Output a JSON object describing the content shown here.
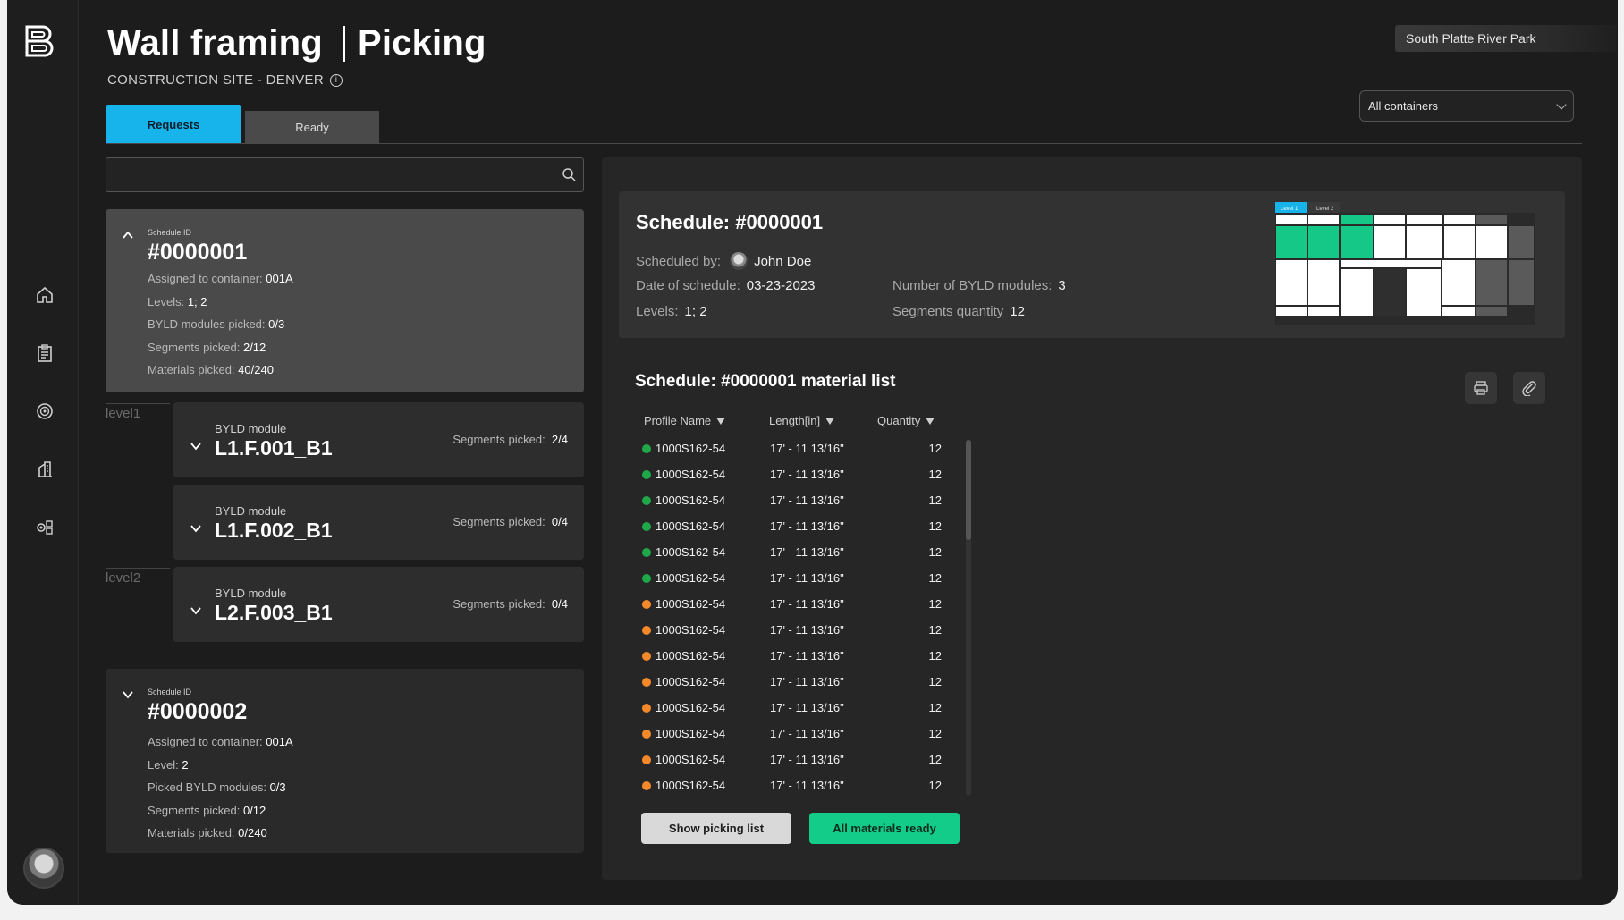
{
  "header": {
    "title": "Wall framing",
    "section": "Picking",
    "subtitle": "CONSTRUCTION SITE - DENVER",
    "site": "South Platte River Park",
    "container_select": "All containers"
  },
  "tabs": [
    {
      "label": "Requests",
      "active": true
    },
    {
      "label": "Ready",
      "active": false
    }
  ],
  "search": {
    "placeholder": ""
  },
  "schedules": [
    {
      "id_label": "Schedule ID",
      "id": "#0000001",
      "rows": [
        {
          "label": "Assigned to container:",
          "value": "001A"
        },
        {
          "label": "Levels:",
          "value": "1; 2"
        },
        {
          "label": "BYLD modules picked:",
          "value": "0/3"
        },
        {
          "label": "Segments picked:",
          "value": "2/12"
        },
        {
          "label": "Materials picked:",
          "value": "40/240"
        }
      ]
    },
    {
      "id_label": "Schedule ID",
      "id": "#0000002",
      "rows": [
        {
          "label": "Assigned to container:",
          "value": "001A"
        },
        {
          "label": "Level:",
          "value": "2"
        },
        {
          "label": "Picked BYLD modules:",
          "value": "0/3"
        },
        {
          "label": "Segments picked:",
          "value": "0/12"
        },
        {
          "label": "Materials picked:",
          "value": "0/240"
        }
      ]
    }
  ],
  "levels": [
    "level1",
    "level2"
  ],
  "modules": [
    {
      "label": "BYLD module",
      "name": "L1.F.001_B1",
      "seg_label": "Segments picked:",
      "seg_value": "2/4"
    },
    {
      "label": "BYLD module",
      "name": "L1.F.002_B1",
      "seg_label": "Segments picked:",
      "seg_value": "0/4"
    },
    {
      "label": "BYLD module",
      "name": "L2.F.003_B1",
      "seg_label": "Segments picked:",
      "seg_value": "0/4"
    }
  ],
  "detail": {
    "title": "Schedule: #0000001",
    "scheduled_by_label": "Scheduled by:",
    "scheduled_by": "John Doe",
    "date_label": "Date of schedule:",
    "date": "03-23-2023",
    "levels_label": "Levels:",
    "levels": "1;  2",
    "modules_label": "Number of BYLD modules:",
    "modules": "3",
    "segments_label": "Segments quantity",
    "segments": "12",
    "map_tabs": [
      "Level 1",
      "Level 2"
    ]
  },
  "material_list": {
    "title": "Schedule: #0000001 material list",
    "columns": [
      "Profile Name",
      "Length[in]",
      "Quantity"
    ],
    "rows": [
      {
        "status": "green",
        "profile": "1000S162-54",
        "length": "17' - 11 13/16\"",
        "qty": "12"
      },
      {
        "status": "green",
        "profile": "1000S162-54",
        "length": "17' - 11 13/16\"",
        "qty": "12"
      },
      {
        "status": "green",
        "profile": "1000S162-54",
        "length": "17' - 11 13/16\"",
        "qty": "12"
      },
      {
        "status": "green",
        "profile": "1000S162-54",
        "length": "17' - 11 13/16\"",
        "qty": "12"
      },
      {
        "status": "green",
        "profile": "1000S162-54",
        "length": "17' - 11 13/16\"",
        "qty": "12"
      },
      {
        "status": "green",
        "profile": "1000S162-54",
        "length": "17' - 11 13/16\"",
        "qty": "12"
      },
      {
        "status": "orange",
        "profile": "1000S162-54",
        "length": "17' - 11 13/16\"",
        "qty": "12"
      },
      {
        "status": "orange",
        "profile": "1000S162-54",
        "length": "17' - 11 13/16\"",
        "qty": "12"
      },
      {
        "status": "orange",
        "profile": "1000S162-54",
        "length": "17' - 11 13/16\"",
        "qty": "12"
      },
      {
        "status": "orange",
        "profile": "1000S162-54",
        "length": "17' - 11 13/16\"",
        "qty": "12"
      },
      {
        "status": "orange",
        "profile": "1000S162-54",
        "length": "17' - 11 13/16\"",
        "qty": "12"
      },
      {
        "status": "orange",
        "profile": "1000S162-54",
        "length": "17' - 11 13/16\"",
        "qty": "12"
      },
      {
        "status": "orange",
        "profile": "1000S162-54",
        "length": "17' - 11 13/16\"",
        "qty": "12"
      },
      {
        "status": "orange",
        "profile": "1000S162-54",
        "length": "17' - 11 13/16\"",
        "qty": "12"
      }
    ]
  },
  "buttons": {
    "show_picking": "Show picking list",
    "all_ready": "All materials ready"
  },
  "colors": {
    "accent": "#17b4ec",
    "green": "#1fa84a",
    "orange": "#f5892a",
    "ready": "#14cc8a"
  },
  "icons": [
    "logo-icon",
    "home-icon",
    "schedule-icon",
    "target-icon",
    "building-icon",
    "settings-icon",
    "search-icon",
    "info-icon",
    "print-icon",
    "attach-icon"
  ]
}
